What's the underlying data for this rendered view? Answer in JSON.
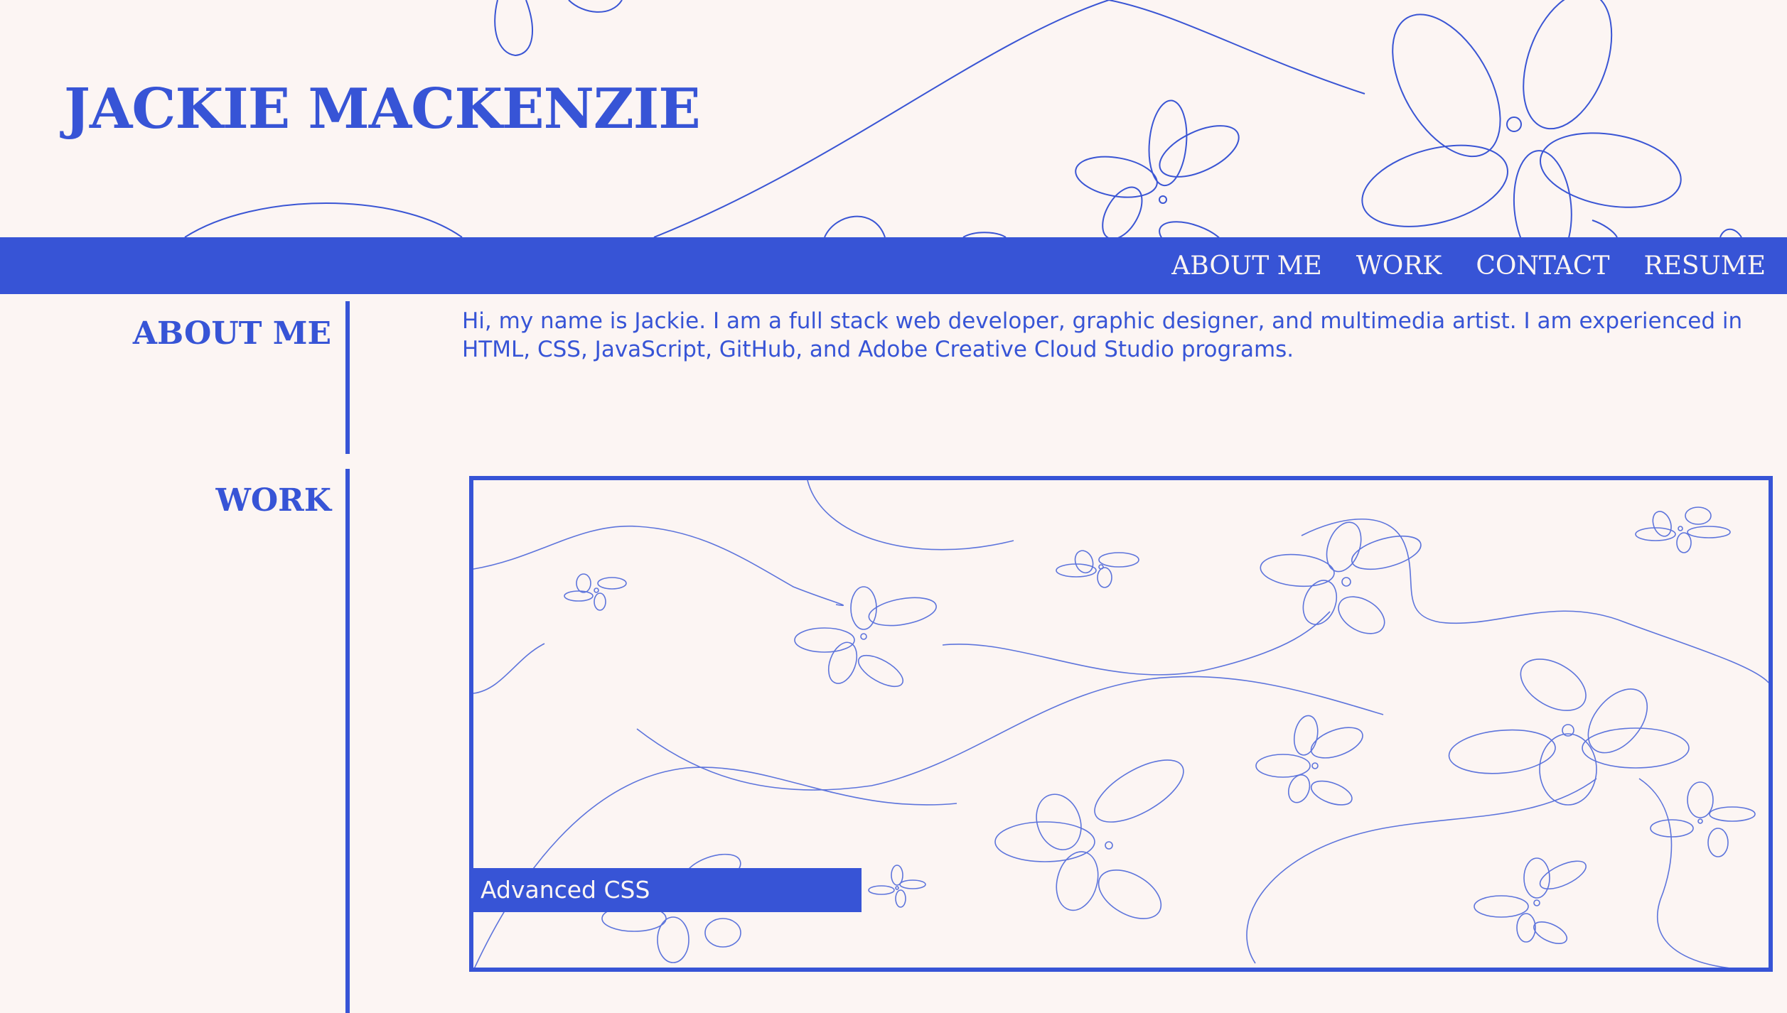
{
  "header": {
    "site_title": "JACKIE MACKENZIE"
  },
  "nav": {
    "items": [
      {
        "label": "ABOUT ME"
      },
      {
        "label": "WORK"
      },
      {
        "label": "CONTACT"
      },
      {
        "label": "RESUME"
      }
    ]
  },
  "about": {
    "heading": "ABOUT ME",
    "text": "Hi, my name is Jackie. I am a full stack web developer, graphic designer, and multimedia artist. I am experienced in HTML, CSS, JavaScript, GitHub, and Adobe Creative Cloud Studio programs."
  },
  "work": {
    "heading": "WORK",
    "projects": [
      {
        "label": "Advanced CSS"
      }
    ]
  },
  "colors": {
    "accent": "#3754d6",
    "background": "#fcf5f3"
  },
  "icons": {
    "header_decoration": "flower-doodle-icon",
    "project_thumbnail": "flower-doodle-pattern"
  }
}
